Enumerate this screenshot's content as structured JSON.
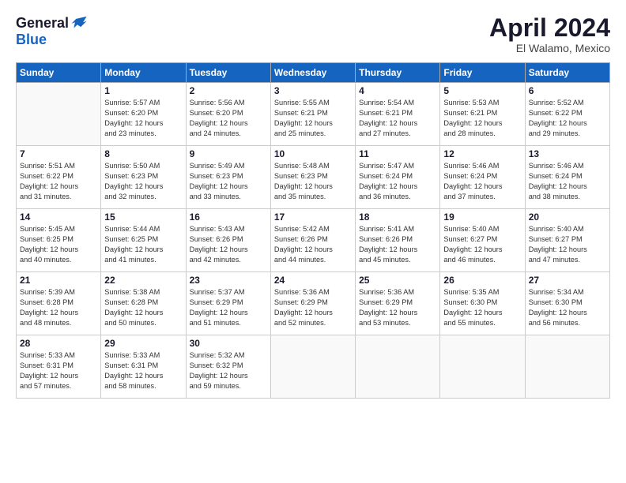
{
  "header": {
    "logo": {
      "general": "General",
      "blue": "Blue"
    },
    "title": "April 2024",
    "subtitle": "El Walamo, Mexico"
  },
  "days_of_week": [
    "Sunday",
    "Monday",
    "Tuesday",
    "Wednesday",
    "Thursday",
    "Friday",
    "Saturday"
  ],
  "weeks": [
    [
      {
        "day": "",
        "info": ""
      },
      {
        "day": "1",
        "info": "Sunrise: 5:57 AM\nSunset: 6:20 PM\nDaylight: 12 hours\nand 23 minutes."
      },
      {
        "day": "2",
        "info": "Sunrise: 5:56 AM\nSunset: 6:20 PM\nDaylight: 12 hours\nand 24 minutes."
      },
      {
        "day": "3",
        "info": "Sunrise: 5:55 AM\nSunset: 6:21 PM\nDaylight: 12 hours\nand 25 minutes."
      },
      {
        "day": "4",
        "info": "Sunrise: 5:54 AM\nSunset: 6:21 PM\nDaylight: 12 hours\nand 27 minutes."
      },
      {
        "day": "5",
        "info": "Sunrise: 5:53 AM\nSunset: 6:21 PM\nDaylight: 12 hours\nand 28 minutes."
      },
      {
        "day": "6",
        "info": "Sunrise: 5:52 AM\nSunset: 6:22 PM\nDaylight: 12 hours\nand 29 minutes."
      }
    ],
    [
      {
        "day": "7",
        "info": "Sunrise: 5:51 AM\nSunset: 6:22 PM\nDaylight: 12 hours\nand 31 minutes."
      },
      {
        "day": "8",
        "info": "Sunrise: 5:50 AM\nSunset: 6:23 PM\nDaylight: 12 hours\nand 32 minutes."
      },
      {
        "day": "9",
        "info": "Sunrise: 5:49 AM\nSunset: 6:23 PM\nDaylight: 12 hours\nand 33 minutes."
      },
      {
        "day": "10",
        "info": "Sunrise: 5:48 AM\nSunset: 6:23 PM\nDaylight: 12 hours\nand 35 minutes."
      },
      {
        "day": "11",
        "info": "Sunrise: 5:47 AM\nSunset: 6:24 PM\nDaylight: 12 hours\nand 36 minutes."
      },
      {
        "day": "12",
        "info": "Sunrise: 5:46 AM\nSunset: 6:24 PM\nDaylight: 12 hours\nand 37 minutes."
      },
      {
        "day": "13",
        "info": "Sunrise: 5:46 AM\nSunset: 6:24 PM\nDaylight: 12 hours\nand 38 minutes."
      }
    ],
    [
      {
        "day": "14",
        "info": "Sunrise: 5:45 AM\nSunset: 6:25 PM\nDaylight: 12 hours\nand 40 minutes."
      },
      {
        "day": "15",
        "info": "Sunrise: 5:44 AM\nSunset: 6:25 PM\nDaylight: 12 hours\nand 41 minutes."
      },
      {
        "day": "16",
        "info": "Sunrise: 5:43 AM\nSunset: 6:26 PM\nDaylight: 12 hours\nand 42 minutes."
      },
      {
        "day": "17",
        "info": "Sunrise: 5:42 AM\nSunset: 6:26 PM\nDaylight: 12 hours\nand 44 minutes."
      },
      {
        "day": "18",
        "info": "Sunrise: 5:41 AM\nSunset: 6:26 PM\nDaylight: 12 hours\nand 45 minutes."
      },
      {
        "day": "19",
        "info": "Sunrise: 5:40 AM\nSunset: 6:27 PM\nDaylight: 12 hours\nand 46 minutes."
      },
      {
        "day": "20",
        "info": "Sunrise: 5:40 AM\nSunset: 6:27 PM\nDaylight: 12 hours\nand 47 minutes."
      }
    ],
    [
      {
        "day": "21",
        "info": "Sunrise: 5:39 AM\nSunset: 6:28 PM\nDaylight: 12 hours\nand 48 minutes."
      },
      {
        "day": "22",
        "info": "Sunrise: 5:38 AM\nSunset: 6:28 PM\nDaylight: 12 hours\nand 50 minutes."
      },
      {
        "day": "23",
        "info": "Sunrise: 5:37 AM\nSunset: 6:29 PM\nDaylight: 12 hours\nand 51 minutes."
      },
      {
        "day": "24",
        "info": "Sunrise: 5:36 AM\nSunset: 6:29 PM\nDaylight: 12 hours\nand 52 minutes."
      },
      {
        "day": "25",
        "info": "Sunrise: 5:36 AM\nSunset: 6:29 PM\nDaylight: 12 hours\nand 53 minutes."
      },
      {
        "day": "26",
        "info": "Sunrise: 5:35 AM\nSunset: 6:30 PM\nDaylight: 12 hours\nand 55 minutes."
      },
      {
        "day": "27",
        "info": "Sunrise: 5:34 AM\nSunset: 6:30 PM\nDaylight: 12 hours\nand 56 minutes."
      }
    ],
    [
      {
        "day": "28",
        "info": "Sunrise: 5:33 AM\nSunset: 6:31 PM\nDaylight: 12 hours\nand 57 minutes."
      },
      {
        "day": "29",
        "info": "Sunrise: 5:33 AM\nSunset: 6:31 PM\nDaylight: 12 hours\nand 58 minutes."
      },
      {
        "day": "30",
        "info": "Sunrise: 5:32 AM\nSunset: 6:32 PM\nDaylight: 12 hours\nand 59 minutes."
      },
      {
        "day": "",
        "info": ""
      },
      {
        "day": "",
        "info": ""
      },
      {
        "day": "",
        "info": ""
      },
      {
        "day": "",
        "info": ""
      }
    ]
  ]
}
